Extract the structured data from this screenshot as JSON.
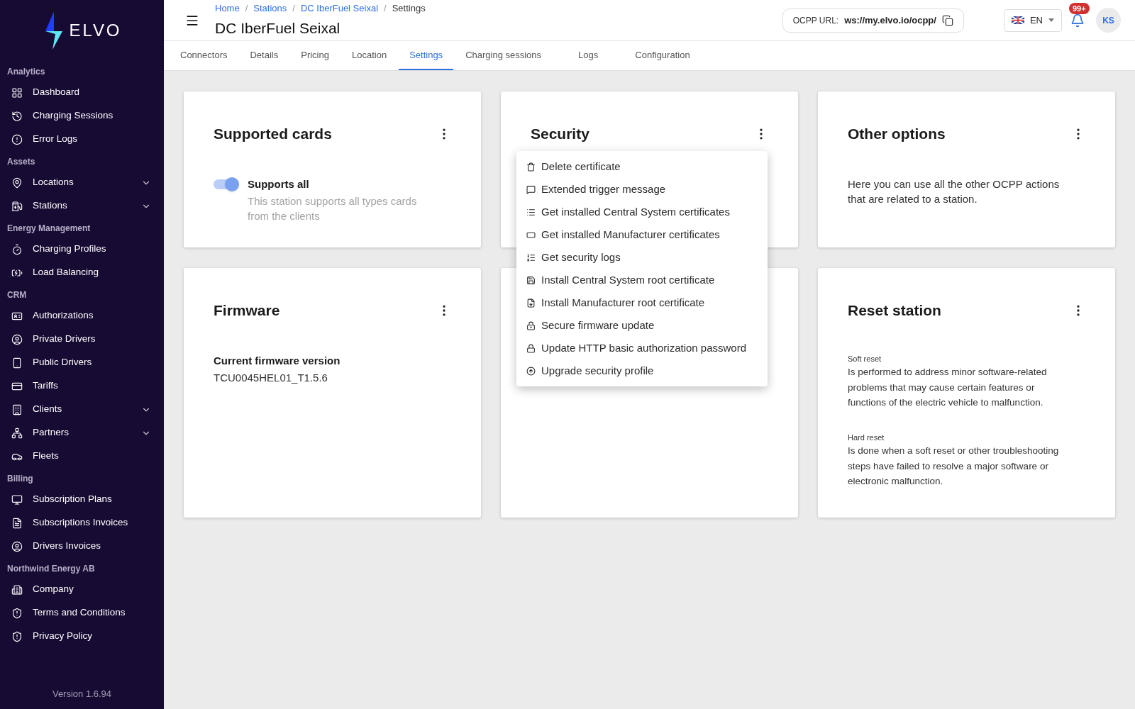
{
  "sidebar": {
    "logo": "ELVO",
    "sections": [
      {
        "title": "Analytics",
        "items": [
          {
            "label": "Dashboard",
            "expandable": false
          },
          {
            "label": "Charging Sessions",
            "expandable": false
          },
          {
            "label": "Error Logs",
            "expandable": false
          }
        ]
      },
      {
        "title": "Assets",
        "items": [
          {
            "label": "Locations",
            "expandable": true
          },
          {
            "label": "Stations",
            "expandable": true
          }
        ]
      },
      {
        "title": "Energy Management",
        "items": [
          {
            "label": "Charging Profiles",
            "expandable": false
          },
          {
            "label": "Load Balancing",
            "expandable": false
          }
        ]
      },
      {
        "title": "CRM",
        "items": [
          {
            "label": "Authorizations",
            "expandable": false
          },
          {
            "label": "Private Drivers",
            "expandable": false
          },
          {
            "label": "Public Drivers",
            "expandable": false
          },
          {
            "label": "Tariffs",
            "expandable": false
          },
          {
            "label": "Clients",
            "expandable": true
          },
          {
            "label": "Partners",
            "expandable": true
          },
          {
            "label": "Fleets",
            "expandable": false
          }
        ]
      },
      {
        "title": "Billing",
        "items": [
          {
            "label": "Subscription Plans",
            "expandable": false
          },
          {
            "label": "Subscriptions Invoices",
            "expandable": false
          },
          {
            "label": "Drivers Invoices",
            "expandable": false
          }
        ]
      },
      {
        "title": "Northwind Energy AB",
        "items": [
          {
            "label": "Company",
            "expandable": false
          },
          {
            "label": "Terms and Conditions",
            "expandable": false
          },
          {
            "label": "Privacy Policy",
            "expandable": false
          }
        ]
      }
    ],
    "version": "Version 1.6.94"
  },
  "header": {
    "breadcrumb": [
      "Home",
      "Stations",
      "DC IberFuel Seixal",
      "Settings"
    ],
    "breadcrumb_separator": "/",
    "title": "DC IberFuel Seixal",
    "ocpp": {
      "label": "OCPP URL:",
      "value": "ws://my.elvo.io/ocpp/"
    },
    "language": "EN",
    "notifications": "99+",
    "avatar": "KS"
  },
  "tabs": [
    {
      "label": "Connectors",
      "selected": false
    },
    {
      "label": "Details",
      "selected": false
    },
    {
      "label": "Pricing",
      "selected": false
    },
    {
      "label": "Location",
      "selected": false
    },
    {
      "label": "Settings",
      "selected": true
    },
    {
      "label": "Charging sessions",
      "selected": false
    },
    {
      "label": "Logs",
      "selected": false
    },
    {
      "label": "Configuration",
      "selected": false
    }
  ],
  "cards": [
    {
      "kind": "toggle",
      "title": "Supported cards",
      "toggle": {
        "on": true,
        "label": "Supports all",
        "description": "This station supports all types cards from the clients"
      }
    },
    {
      "kind": "menu",
      "title": "Security",
      "menu": [
        "Delete certificate",
        "Extended trigger message",
        "Get installed Central System certificates",
        "Get installed Manufacturer certificates",
        "Get security logs",
        "Install Central System root certificate",
        "Install Manufacturer root certificate",
        "Secure firmware update",
        "Update HTTP basic authorization password",
        "Upgrade security profile"
      ]
    },
    {
      "kind": "text",
      "title": "Other options",
      "text": "Here you can use all the other OCPP actions that are related to a station."
    },
    {
      "kind": "field",
      "title": "Firmware",
      "label": "Current firmware version",
      "value": "TCU0045HEL01_T1.5.6"
    },
    {
      "kind": "blank"
    },
    {
      "kind": "sections",
      "title": "Reset station",
      "sections": [
        {
          "label": "Soft reset",
          "text": "Is performed to address minor software-related problems that may cause certain features or functions of the electric vehicle to malfunction."
        },
        {
          "label": "Hard reset",
          "text": "Is done when a soft reset or other troubleshooting steps have failed to resolve a major software or electronic malfunction."
        }
      ]
    }
  ]
}
